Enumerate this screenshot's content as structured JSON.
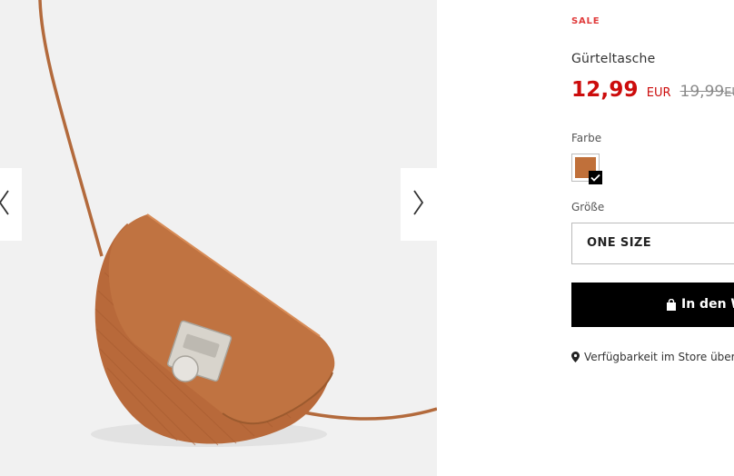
{
  "gallery": {
    "image_alt": "Gürteltasche braun",
    "prev_icon": "chevron-left-icon",
    "next_icon": "chevron-right-icon"
  },
  "product": {
    "sale_label": "SALE",
    "name": "Gürteltasche",
    "price_now": "12,99",
    "price_now_currency": "EUR",
    "price_old": "19,99",
    "price_old_currency": "EUR"
  },
  "color": {
    "label": "Farbe",
    "selected_hex": "#c0703a",
    "check_icon": "check-icon"
  },
  "size": {
    "label": "Größe",
    "selected": "ONE SIZE"
  },
  "cart": {
    "button_label": "In den Warenkorb",
    "icon": "shopping-bag-icon"
  },
  "store": {
    "link_label": "Verfügbarkeit im Store überprüfen",
    "icon": "map-pin-icon"
  },
  "colors": {
    "sale_red": "#e03b3b",
    "price_red": "#cc0c0c",
    "old_price_grey": "#8a8a8a",
    "button_black": "#000000"
  }
}
